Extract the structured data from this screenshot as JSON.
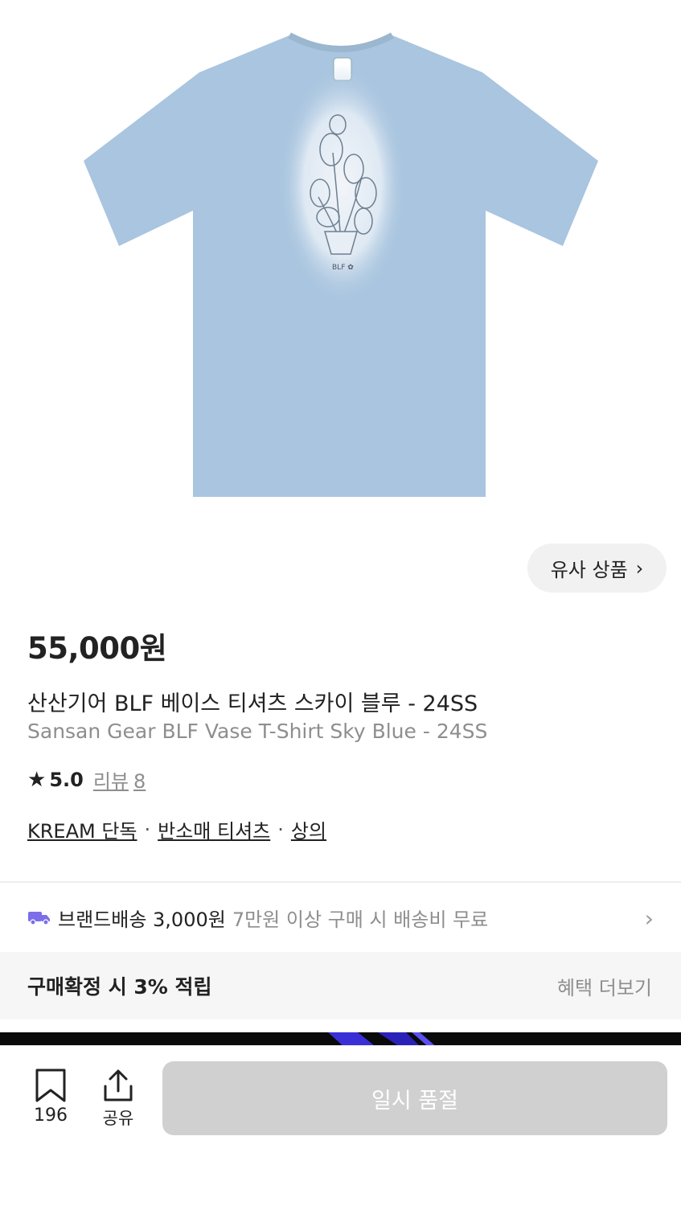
{
  "product": {
    "image_alt": "Sky blue T-shirt with vase graphic",
    "price": "55,000원",
    "title_ko": "산산기어 BLF 베이스 티셔츠 스카이 블루 - 24SS",
    "title_en": "Sansan Gear BLF Vase T-Shirt Sky Blue - 24SS",
    "shirt_color": "#a9c5df"
  },
  "similar_button": {
    "label": "유사 상품",
    "icon": "chevron-right-icon"
  },
  "rating": {
    "score": "5.0",
    "reviews_label": "리뷰",
    "reviews_count": "8"
  },
  "tags": [
    "KREAM 단독",
    "반소매 티셔츠",
    "상의"
  ],
  "shipping": {
    "label": "브랜드배송 3,000원",
    "note": "7만원 이상 구매 시 배송비 무료",
    "icon_color": "#7b6ee8"
  },
  "benefit": {
    "label": "구매확정 시 3% 적립",
    "more": "혜택 더보기"
  },
  "bottom_bar": {
    "wish_count": "196",
    "share_label": "공유",
    "buy_label": "일시 품절"
  }
}
